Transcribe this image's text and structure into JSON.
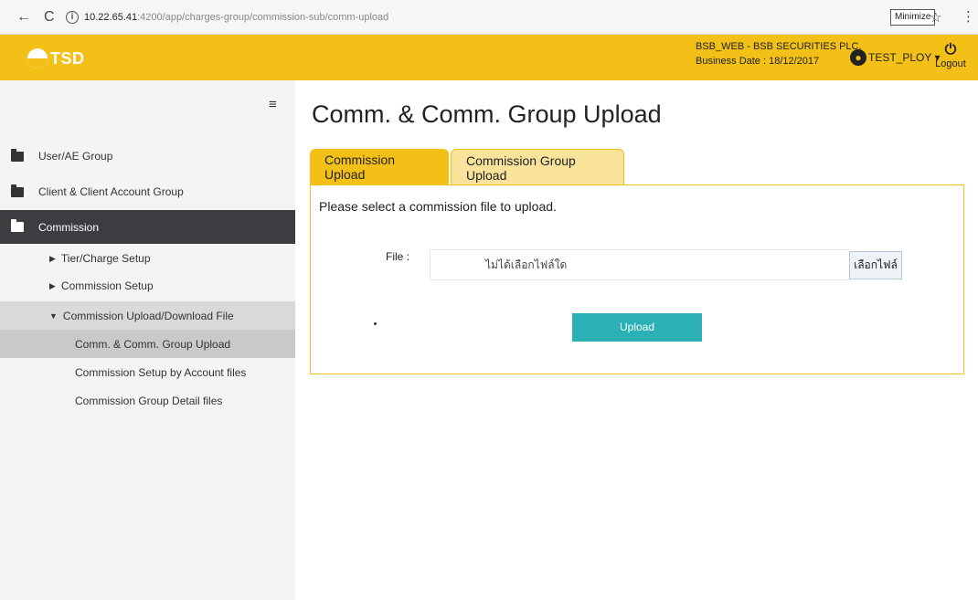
{
  "browser": {
    "back_glyph": "←",
    "reload_glyph": "C",
    "info_glyph": "i",
    "url_host": "10.22.65.41",
    "url_rest": ":4200/app/charges-group/commission-sub/comm-upload",
    "minimize_label": "Minimize",
    "star_glyph": "☆",
    "menu_glyph": "⋮"
  },
  "header": {
    "logo_text": "TSD",
    "company_line": "BSB_WEB - BSB SECURITIES PLC.",
    "business_date": "Business Date : 18/12/2017",
    "user_label": "TEST_PLOY ▾",
    "logout_glyph": "⏻",
    "logout_label": "Logout",
    "brand_color": "#f2c017"
  },
  "sidebar": {
    "toggle_glyph": "≡",
    "items": [
      {
        "label": "User/AE Group",
        "icon": "folder-icon"
      },
      {
        "label": "Client & Client Account Group",
        "icon": "folder-icon"
      },
      {
        "label": "Commission",
        "icon": "folder-open-icon",
        "active": true
      }
    ],
    "submenus": [
      {
        "caret": "▶",
        "label": "Tier/Charge Setup"
      },
      {
        "caret": "▶",
        "label": "Commission Setup"
      },
      {
        "caret": "▼",
        "label": "Commission Upload/Download File",
        "expanded": true
      }
    ],
    "leaves": [
      {
        "label": "Comm. & Comm. Group Upload",
        "active": true
      },
      {
        "label": "Commission Setup by Account files"
      },
      {
        "label": "Commission Group Detail files"
      }
    ]
  },
  "main": {
    "title": "Comm. & Comm. Group Upload",
    "tabs": [
      {
        "label": "Commission Upload"
      },
      {
        "label": "Commission Group Upload"
      }
    ],
    "instruction": "Please select a commission file to upload.",
    "file_label": "File :",
    "file_value": "ไม่ได้เลือกไฟล์ใด",
    "choose_button": "เลือกไฟล์",
    "upload_button": "Upload",
    "accent_color": "#2ab0b5"
  }
}
